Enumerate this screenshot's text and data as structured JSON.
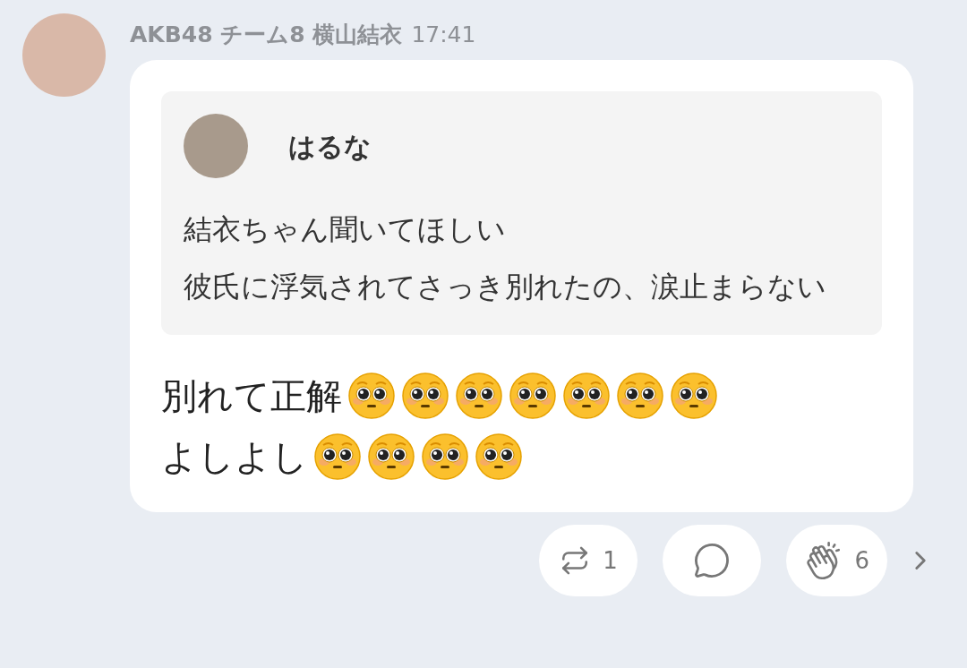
{
  "post": {
    "author": "AKB48 チーム8 横山結衣",
    "time": "17:41",
    "quote": {
      "author": "はるな",
      "lines": [
        "結衣ちゃん聞いてほしい",
        "彼氏に浮気されてさっき別れたの、涙止まらない"
      ]
    },
    "lines": [
      {
        "text": "別れて正解",
        "emojis": [
          {
            "kind": "pleading"
          },
          {
            "kind": "pleading"
          },
          {
            "kind": "pleading"
          },
          {
            "kind": "pleading"
          },
          {
            "kind": "pleading"
          },
          {
            "kind": "pleading"
          },
          {
            "kind": "pleading"
          }
        ]
      },
      {
        "text": "よしよし",
        "emojis": [
          {
            "kind": "pleading"
          },
          {
            "kind": "pleading"
          },
          {
            "kind": "pleading"
          },
          {
            "kind": "pleading"
          }
        ]
      }
    ]
  },
  "actions": [
    {
      "kind": "repost",
      "count": "1"
    },
    {
      "kind": "comment"
    },
    {
      "kind": "clap",
      "count": "6"
    }
  ]
}
